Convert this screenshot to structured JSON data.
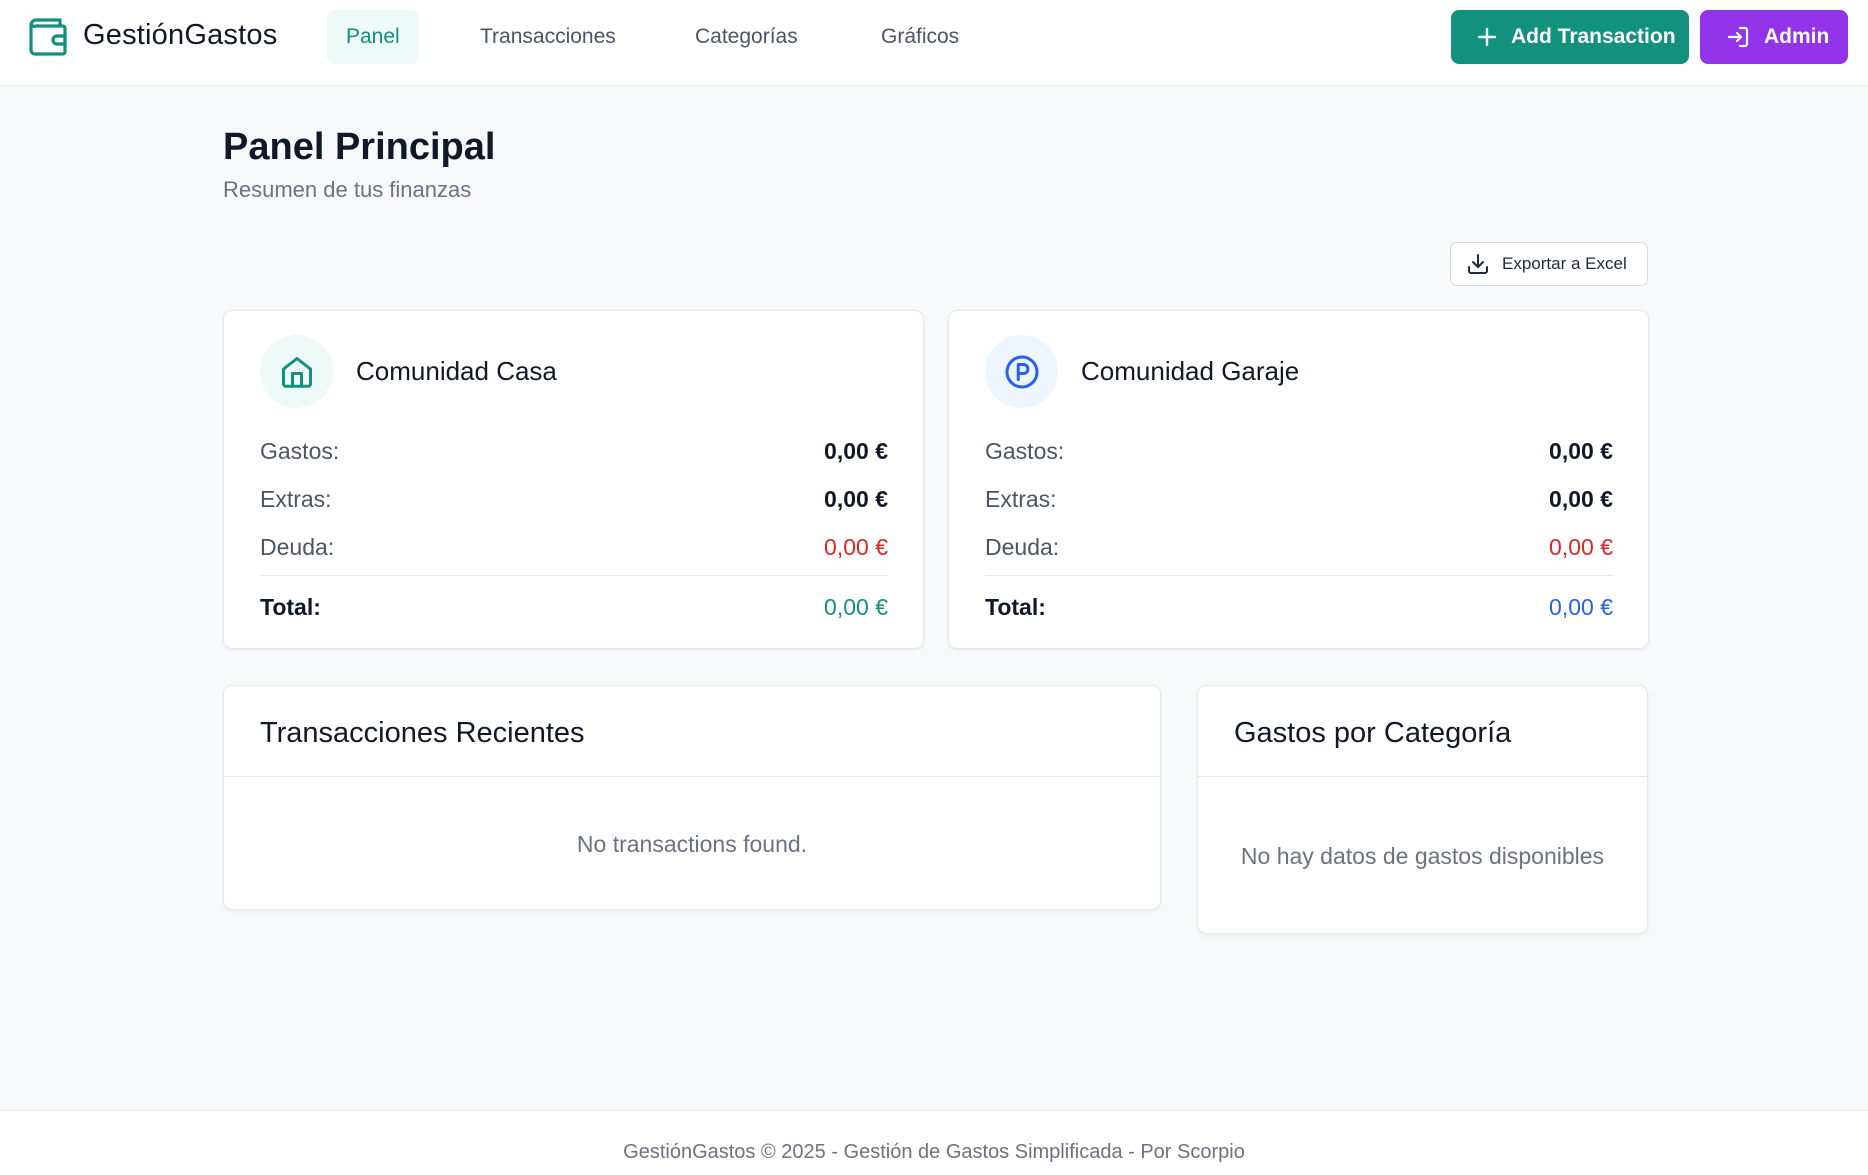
{
  "app": {
    "brand": "GestiónGastos"
  },
  "nav": {
    "items": [
      {
        "label": "Panel",
        "active": true
      },
      {
        "label": "Transacciones",
        "active": false
      },
      {
        "label": "Categorías",
        "active": false
      },
      {
        "label": "Gráficos",
        "active": false
      }
    ]
  },
  "header_actions": {
    "add_label": "Add Transaction",
    "admin_label": "Admin"
  },
  "page": {
    "title": "Panel Principal",
    "subtitle": "Resumen de tus finanzas",
    "export_label": "Exportar a Excel"
  },
  "cards": {
    "casa": {
      "title": "Comunidad Casa",
      "icon": "home-icon",
      "rows": [
        {
          "label": "Gastos:",
          "value": "0,00 €"
        },
        {
          "label": "Extras:",
          "value": "0,00 €"
        },
        {
          "label": "Deuda:",
          "value": "0,00 €"
        }
      ],
      "total_label": "Total:",
      "total_value": "0,00 €"
    },
    "garaje": {
      "title": "Comunidad Garaje",
      "icon": "parking-icon",
      "rows": [
        {
          "label": "Gastos:",
          "value": "0,00 €"
        },
        {
          "label": "Extras:",
          "value": "0,00 €"
        },
        {
          "label": "Deuda:",
          "value": "0,00 €"
        }
      ],
      "total_label": "Total:",
      "total_value": "0,00 €"
    }
  },
  "recent": {
    "title": "Transacciones Recientes",
    "empty": "No transactions found."
  },
  "categories": {
    "title": "Gastos por Categoría",
    "empty": "No hay datos de gastos disponibles"
  },
  "footer": {
    "text": "GestiónGastos © 2025 - Gestión de Gastos Simplificada - Por Scorpio"
  },
  "colors": {
    "primary": "#13917f",
    "admin": "#9333ea",
    "debt": "#dc2626",
    "garaje_total": "#2563eb"
  }
}
